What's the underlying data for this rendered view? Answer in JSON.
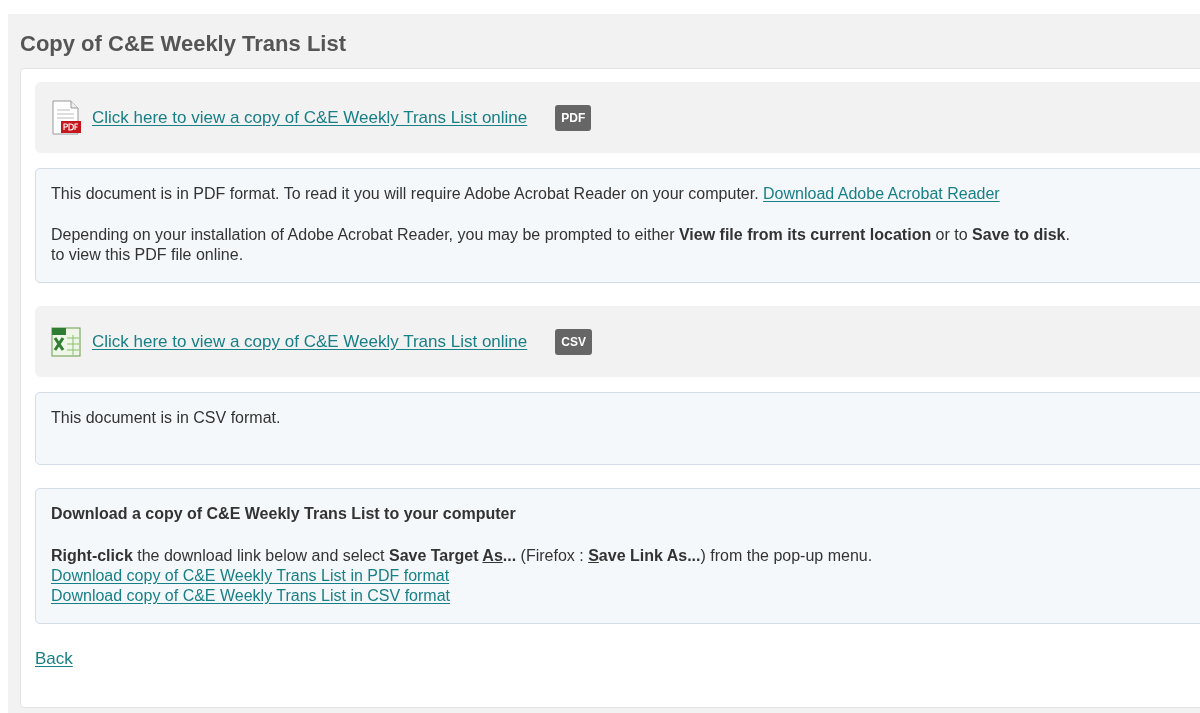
{
  "title": "Copy of C&E Weekly Trans List",
  "documents": [
    {
      "kind": "pdf",
      "link": "Click here to view a copy of C&E Weekly Trans List online",
      "badge": "PDF",
      "info_lines": [
        "This document is in PDF format. To read it you will require Adobe Acrobat Reader on your computer."
      ],
      "info_link": "Download Adobe Acrobat Reader",
      "info_paragraph": [
        "Depending on your installation of Adobe Acrobat Reader, you may be prompted to either **View file from its current location** or to **Save to disk**.",
        "to view this PDF file online."
      ]
    },
    {
      "kind": "csv",
      "link": "Click here to view a copy of C&E Weekly Trans List online",
      "badge": "CSV",
      "info_lines": [
        "This document is in CSV format."
      ]
    }
  ],
  "download": {
    "heading": "Download a copy of C&E Weekly Trans List to your computer",
    "instruction": [
      {
        "text": "Right-click",
        "bold": true,
        "underline": false
      },
      {
        "text": " the download link below and select ",
        "bold": false,
        "underline": false
      },
      {
        "text": "Save Target ",
        "bold": true,
        "underline": false
      },
      {
        "text": "As",
        "bold": true,
        "underline": true
      },
      {
        "text": "...",
        "bold": true,
        "underline": false
      },
      {
        "text": " (Firefox : ",
        "bold": false,
        "underline": false
      },
      {
        "text": "S",
        "bold": true,
        "underline": true
      },
      {
        "text": "ave Link As...",
        "bold": true,
        "underline": false
      },
      {
        "text": ") from the pop-up menu.",
        "bold": false,
        "underline": false
      }
    ],
    "links": [
      "Download copy of C&E Weekly Trans List in PDF format",
      "Download copy of C&E Weekly Trans List in CSV format"
    ]
  },
  "back": "Back"
}
